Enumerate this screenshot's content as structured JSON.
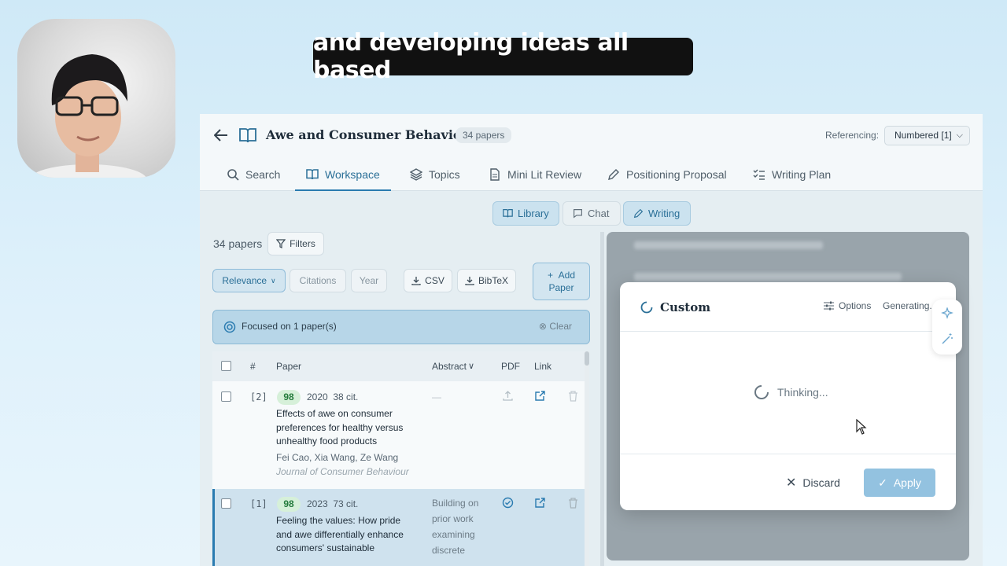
{
  "caption": "and developing ideas all based",
  "header": {
    "title": "Awe and Consumer Behavior",
    "paper_count_badge": "34 papers",
    "referencing_label": "Referencing:",
    "referencing_value": "Numbered [1]"
  },
  "tabs": [
    {
      "label": "Search"
    },
    {
      "label": "Workspace"
    },
    {
      "label": "Topics"
    },
    {
      "label": "Mini Lit Review"
    },
    {
      "label": "Positioning Proposal"
    },
    {
      "label": "Writing Plan"
    }
  ],
  "segments": {
    "library": "Library",
    "chat": "Chat",
    "writing": "Writing"
  },
  "library": {
    "count_label": "34 papers",
    "filters_label": "Filters",
    "sort_label": "Relevance",
    "citations_label": "Citations",
    "year_label": "Year",
    "csv_label": "CSV",
    "bibtex_label": "BibTeX",
    "add_paper_line1": "Add",
    "add_paper_line2": "Paper",
    "focus_text": "Focused on 1 paper(s)",
    "clear_label": "Clear"
  },
  "table": {
    "headers": {
      "num": "#",
      "paper": "Paper",
      "abstract": "Abstract",
      "pdf": "PDF",
      "link": "Link"
    },
    "rows": [
      {
        "index": "[2]",
        "score": "98",
        "year": "2020",
        "citations": "38 cit.",
        "title": "Effects of awe on consumer preferences for healthy versus unhealthy food products",
        "authors": "Fei Cao, Xia Wang, Ze Wang",
        "journal": "Journal of Consumer Behaviour",
        "abstract": "—"
      },
      {
        "index": "[1]",
        "score": "98",
        "year": "2023",
        "citations": "73 cit.",
        "title": "Feeling the values: How pride and awe differentially enhance consumers' sustainable",
        "abstract": "Building on prior work examining discrete"
      }
    ]
  },
  "modal": {
    "title": "Custom",
    "options_label": "Options",
    "status": "Generating...",
    "thinking": "Thinking...",
    "discard_label": "Discard",
    "apply_label": "Apply"
  },
  "colors": {
    "accent": "#2a7bb0",
    "score_bg": "#d6f0d9",
    "apply": "#93c2e0"
  }
}
